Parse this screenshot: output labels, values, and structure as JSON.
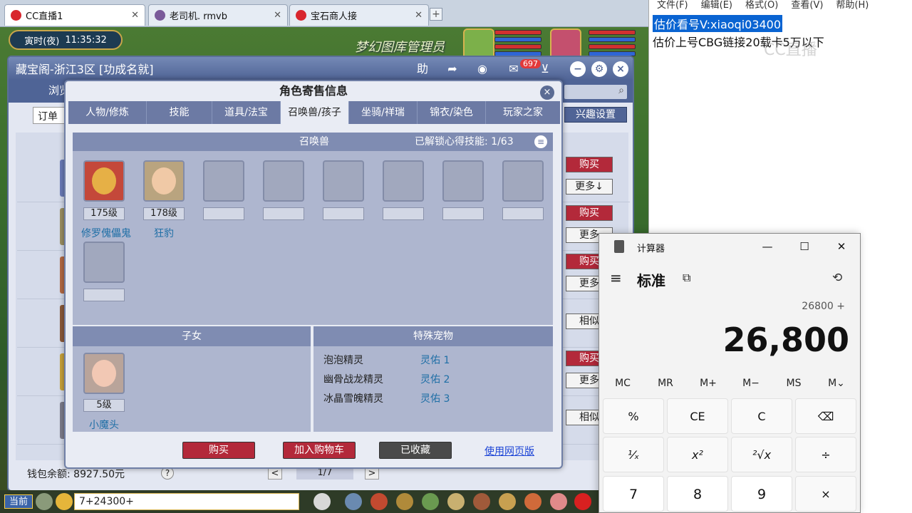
{
  "browser": {
    "tabs": [
      {
        "label": "CC直播1"
      },
      {
        "label": "老司机. rmvb"
      },
      {
        "label": "宝石商人接"
      }
    ],
    "new_tab": "+"
  },
  "game": {
    "clock_period": "寅时(夜)",
    "clock_time": "11:35:32",
    "bg_title": "梦幻图库管理员",
    "window_title": "藏宝阁-浙江3区 [功成名就]",
    "toolbar": {
      "help": "助",
      "badge": "697"
    },
    "browse": "浏览",
    "order_label": "订单",
    "interest_button": "兴趣设置",
    "row_buttons": [
      "购买",
      "更多↓",
      "购买",
      "更多",
      "购买",
      "更多",
      "相似",
      "购买",
      "更多",
      "相似"
    ],
    "wallet": "钱包余额: 8927.50元",
    "help_icon": "?",
    "pager": {
      "prev": "<",
      "page": "1/7",
      "next": ">"
    },
    "chat": {
      "channel": "当前",
      "input": "7+24300+"
    }
  },
  "dialog": {
    "title": "角色寄售信息",
    "close": "×",
    "tabs": [
      "人物/修炼",
      "技能",
      "道具/法宝",
      "召唤兽/孩子",
      "坐骑/祥瑞",
      "锦衣/染色",
      "玩家之家"
    ],
    "active_tab": 3,
    "pet_header": "召唤兽",
    "skills_unlocked": "已解锁心得技能: 1/63",
    "pets": [
      {
        "level": "175级",
        "name": "修罗傀儡鬼"
      },
      {
        "level": "178级",
        "name": "狂豹"
      }
    ],
    "children_header": "子女",
    "child": {
      "level": "5级",
      "name": "小魔头"
    },
    "special_header": "特殊宠物",
    "special_pets": [
      {
        "name": "泡泡精灵",
        "value": "灵佑 1"
      },
      {
        "name": "幽骨战龙精灵",
        "value": "灵佑 2"
      },
      {
        "name": "冰晶雪魄精灵",
        "value": "灵佑 3"
      }
    ],
    "buttons": {
      "buy": "购买",
      "add_cart": "加入购物车",
      "favorited": "已收藏",
      "web": "使用网页版"
    }
  },
  "notepad": {
    "menu": [
      "文件(F)",
      "编辑(E)",
      "格式(O)",
      "查看(V)",
      "帮助(H)"
    ],
    "line1": "估价看号V:xiaoqi03400",
    "line2": "估价上号CBG链接20载卡5万以下",
    "watermark": "CC直播"
  },
  "calculator": {
    "title": "计算器",
    "mode": "标准",
    "expression": "26800 +",
    "display": "26,800",
    "memory": [
      "MC",
      "MR",
      "M+",
      "M−",
      "MS",
      "M⌄"
    ],
    "keys": [
      "%",
      "CE",
      "C",
      "⌫",
      "¹⁄ₓ",
      "x²",
      "²√x",
      "÷",
      "7",
      "8",
      "9",
      "×"
    ]
  },
  "colors": {
    "dialog_tab_bar": "#6c7aa4",
    "buy_red": "#b3293a",
    "link_blue": "#1c44d6",
    "pet_name_blue": "#1f6fa6",
    "notepad_select": "#0a64d2"
  }
}
